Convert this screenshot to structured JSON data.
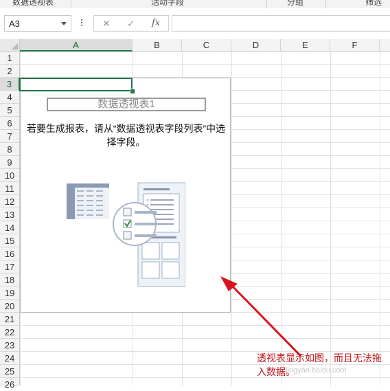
{
  "ribbon_groups": [
    "数据透视表",
    "活动字段",
    "分组",
    "筛选"
  ],
  "formula_bar": {
    "name_box": "A3",
    "cancel_glyph": "✕",
    "enter_glyph": "✓",
    "function_label": "fx",
    "formula_value": ""
  },
  "columns": [
    "A",
    "B",
    "C",
    "D",
    "E",
    "F"
  ],
  "rows": [
    "1",
    "2",
    "3",
    "4",
    "5",
    "6",
    "7",
    "8",
    "9",
    "10",
    "11",
    "12",
    "13",
    "14",
    "15",
    "16",
    "17",
    "18",
    "19",
    "20",
    "21",
    "22",
    "23",
    "24",
    "25",
    "26"
  ],
  "active_cell": {
    "column": "A",
    "row": "3"
  },
  "pivot": {
    "name": "数据透视表1",
    "instruction": "若要生成报表，请从“数据透视表字段列表”中选择字段。"
  },
  "annotation": {
    "text": "透视表显示如图，而且无法拖入数据。",
    "color": "#c0141c"
  },
  "watermark": "jingyan.baidu.com",
  "colors": {
    "accent": "#217346",
    "arrow": "#d9141c"
  },
  "icons": [
    "dropdown-arrow-icon",
    "more-options-icon",
    "cancel-icon",
    "enter-icon",
    "insert-function-icon",
    "select-all-icon"
  ]
}
